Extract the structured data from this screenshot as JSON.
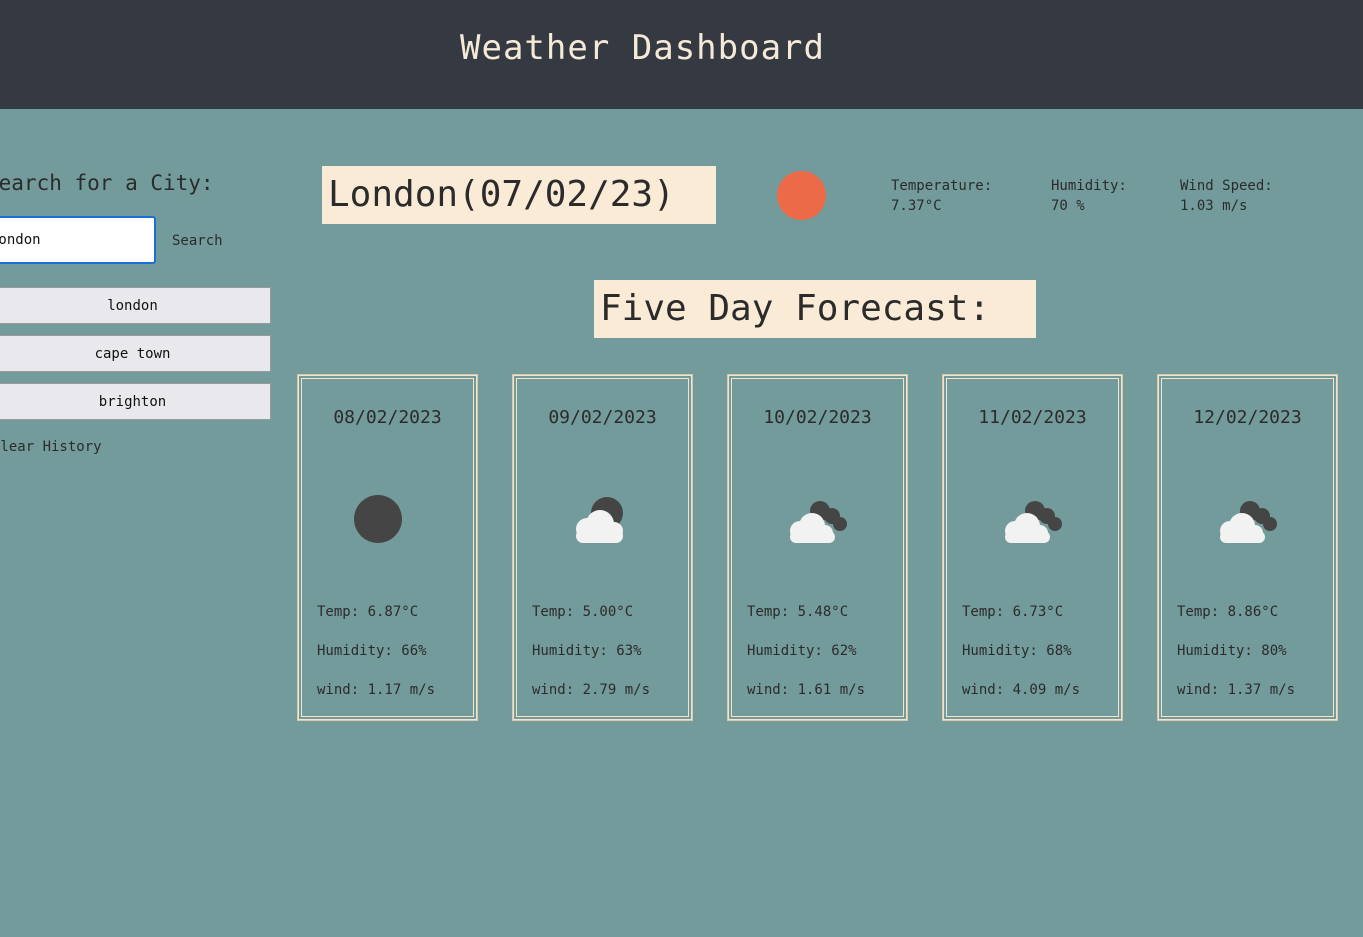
{
  "header": {
    "title": "Weather Dashboard"
  },
  "sidebar": {
    "search_label": "Search for a City:",
    "search_value": "London",
    "search_button": "Search",
    "history": [
      "london",
      "cape town",
      "brighton"
    ],
    "clear_history": "Clear History"
  },
  "current": {
    "city_date": "London(07/02/23)",
    "icon": "sun-icon",
    "icon_color": "#ec6a48",
    "temperature_label": "Temperature:",
    "temperature_value": "7.37°C",
    "humidity_label": "Humidity:",
    "humidity_value": "70 %",
    "wind_label": "Wind Speed:",
    "wind_value": "1.03 m/s"
  },
  "forecast": {
    "title": "Five Day Forecast:",
    "days": [
      {
        "date": "08/02/2023",
        "icon": "moon-icon",
        "temp": "Temp: 6.87°C",
        "humidity": "Humidity: 66%",
        "wind": "wind: 1.17 m/s"
      },
      {
        "date": "09/02/2023",
        "icon": "partly-cloudy-night-icon",
        "temp": "Temp: 5.00°C",
        "humidity": "Humidity: 63%",
        "wind": "wind: 2.79 m/s"
      },
      {
        "date": "10/02/2023",
        "icon": "cloudy-night-icon",
        "temp": "Temp: 5.48°C",
        "humidity": "Humidity: 62%",
        "wind": "wind: 1.61 m/s"
      },
      {
        "date": "11/02/2023",
        "icon": "cloudy-night-icon",
        "temp": "Temp: 6.73°C",
        "humidity": "Humidity: 68%",
        "wind": "wind: 4.09 m/s"
      },
      {
        "date": "12/02/2023",
        "icon": "cloudy-night-icon",
        "temp": "Temp: 8.86°C",
        "humidity": "Humidity: 80%",
        "wind": "wind: 1.37 m/s"
      }
    ]
  },
  "colors": {
    "background": "#739b9b",
    "header": "#353941",
    "panel": "#faebd7"
  }
}
